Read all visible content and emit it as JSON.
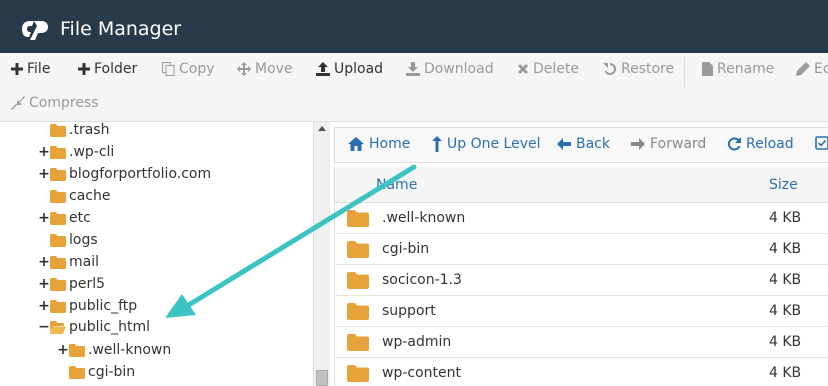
{
  "app": {
    "title": "File Manager",
    "logo_icon": "cpanel-logo"
  },
  "colors": {
    "header_bg": "#293a4a",
    "link": "#2a6fb0",
    "folder": "#e8a23a",
    "annotation_arrow": "#3cc4c4"
  },
  "toolbar": {
    "row1": [
      {
        "label": "File",
        "icon": "plus-icon",
        "enabled": true
      },
      {
        "label": "Folder",
        "icon": "plus-icon",
        "enabled": true
      },
      {
        "label": "Copy",
        "icon": "copy-icon",
        "enabled": false
      },
      {
        "label": "Move",
        "icon": "move-icon",
        "enabled": false
      },
      {
        "label": "Upload",
        "icon": "upload-icon",
        "enabled": true
      },
      {
        "label": "Download",
        "icon": "download-icon",
        "enabled": false
      },
      {
        "label": "Delete",
        "icon": "delete-icon",
        "enabled": false
      },
      {
        "label": "Restore",
        "icon": "restore-icon",
        "enabled": false
      },
      {
        "label": "Rename",
        "icon": "rename-icon",
        "enabled": false
      },
      {
        "label": "Ec",
        "icon": "edit-icon",
        "enabled": false
      }
    ],
    "row2": [
      {
        "label": "Compress",
        "icon": "compress-icon",
        "enabled": false
      }
    ]
  },
  "tree": {
    "items": [
      {
        "label": ".trash",
        "expander": ""
      },
      {
        "label": ".wp-cli",
        "expander": "+"
      },
      {
        "label": "blogforportfolio.com",
        "expander": "+"
      },
      {
        "label": "cache",
        "expander": ""
      },
      {
        "label": "etc",
        "expander": "+"
      },
      {
        "label": "logs",
        "expander": ""
      },
      {
        "label": "mail",
        "expander": "+"
      },
      {
        "label": "perl5",
        "expander": "+"
      },
      {
        "label": "public_ftp",
        "expander": "+"
      },
      {
        "label": "public_html",
        "expander": "−",
        "selected": true
      },
      {
        "label": ".well-known",
        "expander": "+"
      },
      {
        "label": "cgi-bin",
        "expander": ""
      }
    ]
  },
  "navbar": {
    "buttons": [
      {
        "label": "Home",
        "icon": "home-icon",
        "enabled": true
      },
      {
        "label": "Up One Level",
        "icon": "up-arrow-icon",
        "enabled": true
      },
      {
        "label": "Back",
        "icon": "back-arrow-icon",
        "enabled": true
      },
      {
        "label": "Forward",
        "icon": "forward-arrow-icon",
        "enabled": false
      },
      {
        "label": "Reload",
        "icon": "reload-icon",
        "enabled": true
      },
      {
        "label": "",
        "icon": "checkbox-icon",
        "enabled": true
      }
    ]
  },
  "files": {
    "columns": [
      "Name",
      "Size"
    ],
    "rows": [
      {
        "name": ".well-known",
        "size": "4 KB"
      },
      {
        "name": "cgi-bin",
        "size": "4 KB"
      },
      {
        "name": "socicon-1.3",
        "size": "4 KB"
      },
      {
        "name": "support",
        "size": "4 KB"
      },
      {
        "name": "wp-admin",
        "size": "4 KB"
      },
      {
        "name": "wp-content",
        "size": "4 KB"
      }
    ]
  }
}
